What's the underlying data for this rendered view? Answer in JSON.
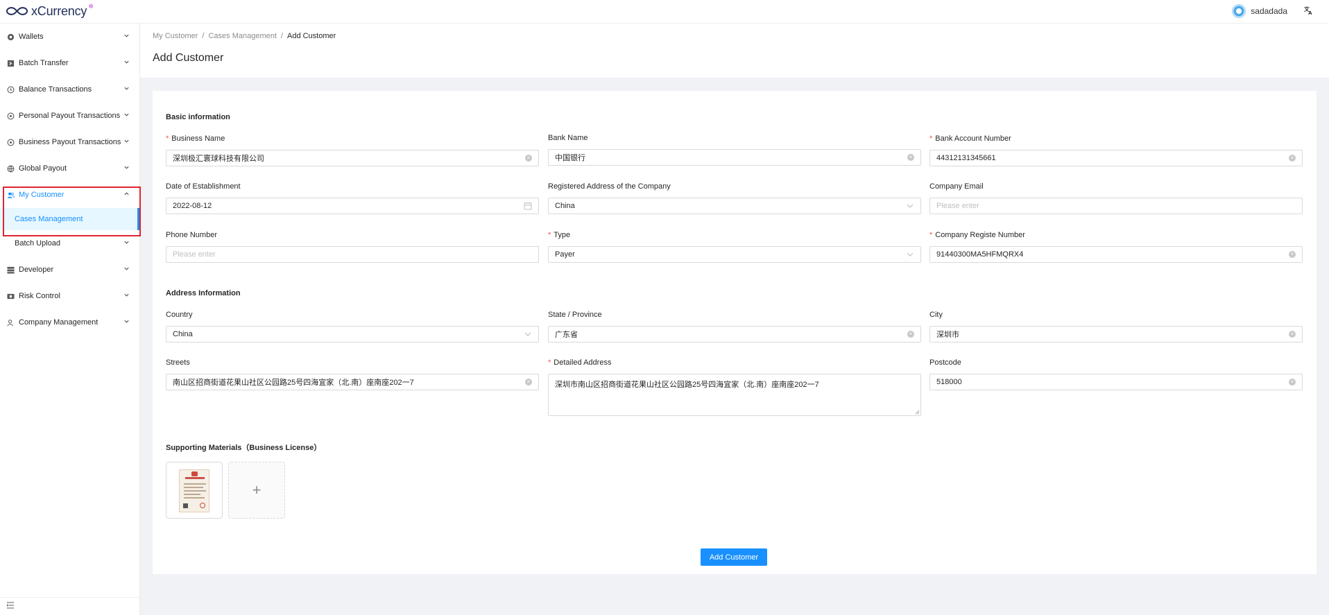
{
  "app": {
    "name": "xCurrency",
    "username": "sadadada",
    "brand_color": "#1890ff",
    "required_color": "#ff4d4f",
    "highlight_color": "#e0222f"
  },
  "sidebar": {
    "items": [
      {
        "label": "Wallets",
        "icon": "wallet-icon"
      },
      {
        "label": "Batch Transfer",
        "icon": "transfer-icon"
      },
      {
        "label": "Balance Transactions",
        "icon": "balance-icon"
      },
      {
        "label": "Personal Payout Transactions",
        "icon": "payout-icon"
      },
      {
        "label": "Business Payout Transactions",
        "icon": "payout-icon"
      },
      {
        "label": "Global Payout",
        "icon": "globe-icon"
      },
      {
        "label": "My Customer",
        "icon": "users-icon",
        "expanded": true
      },
      {
        "label": "Batch Upload",
        "icon": ""
      },
      {
        "label": "Developer",
        "icon": "developer-icon"
      },
      {
        "label": "Risk Control",
        "icon": "risk-icon"
      },
      {
        "label": "Company Management",
        "icon": "company-icon"
      }
    ],
    "submenu": {
      "label": "Cases Management"
    }
  },
  "breadcrumb": [
    "My Customer",
    "Cases Management",
    "Add Customer"
  ],
  "page_title": "Add Customer",
  "form": {
    "basic_title": "Basic information",
    "business_name": {
      "label": "Business Name",
      "value": "深圳极汇寰球科技有限公司"
    },
    "bank_name": {
      "label": "Bank Name",
      "value": "中国银行"
    },
    "bank_account": {
      "label": "Bank Account Number",
      "value": "44312131345661"
    },
    "date_established": {
      "label": "Date of Establishment",
      "value": "2022-08-12"
    },
    "registered_address": {
      "label": "Registered Address of the Company",
      "value": "China"
    },
    "company_email": {
      "label": "Company Email",
      "placeholder": "Please enter"
    },
    "phone": {
      "label": "Phone Number",
      "placeholder": "Please enter"
    },
    "type": {
      "label": "Type",
      "value": "Payer"
    },
    "company_reg": {
      "label": "Company Registe Number",
      "value": "91440300MA5HFMQRX4"
    },
    "address_title": "Address Information",
    "country": {
      "label": "Country",
      "value": "China"
    },
    "state": {
      "label": "State / Province",
      "value": "广东省"
    },
    "city": {
      "label": "City",
      "value": "深圳市"
    },
    "streets": {
      "label": "Streets",
      "value": "南山区招商街道花果山社区公园路25号四海宜家（北.南）座南座202一7"
    },
    "detailed_address": {
      "label": "Detailed Address",
      "value": "深圳市南山区招商街道花果山社区公园路25号四海宜家（北.南）座南座202一7"
    },
    "postcode": {
      "label": "Postcode",
      "value": "518000"
    },
    "materials_title": "Supporting Materials（Business License）",
    "submit_label": "Add Customer"
  }
}
